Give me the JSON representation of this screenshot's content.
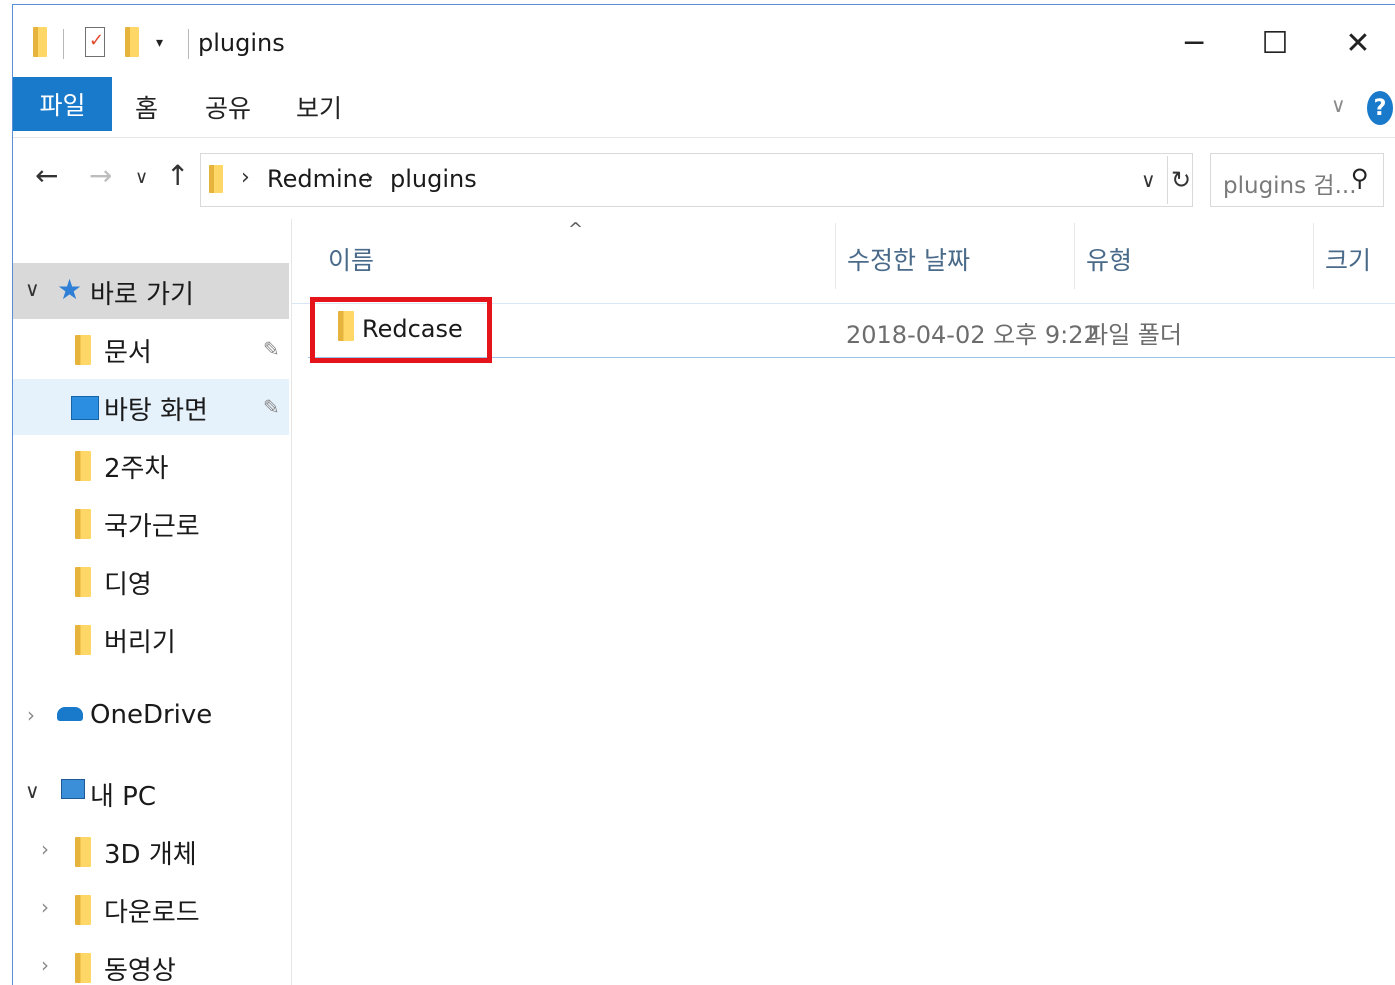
{
  "window": {
    "title": "plugins"
  },
  "quick_access_toolbar": {
    "dropdown_glyph": "▾"
  },
  "window_controls": {
    "minimize": "─",
    "maximize": "☐",
    "close": "✕"
  },
  "ribbon": {
    "tabs": [
      "파일",
      "홈",
      "공유",
      "보기"
    ],
    "expand_glyph": "∨",
    "help": "?"
  },
  "nav": {
    "back": "←",
    "forward": "→",
    "recent": "∨",
    "up": "↑"
  },
  "address": {
    "breadcrumbs": [
      "Redmine",
      "plugins"
    ],
    "separator": "›",
    "dropdown": "∨",
    "refresh": "↻"
  },
  "search": {
    "placeholder": "plugins 검...",
    "icon": "search-icon"
  },
  "sidebar": {
    "quick_access": {
      "label": "바로 가기",
      "expander": "∨"
    },
    "pinned": [
      {
        "label": "문서",
        "icon": "documents-icon"
      },
      {
        "label": "바탕 화면",
        "icon": "desktop-icon"
      }
    ],
    "folders": [
      "2주차",
      "국가근로",
      "디영",
      "버리기"
    ],
    "onedrive": {
      "label": "OneDrive",
      "expander": "›"
    },
    "this_pc": {
      "label": "내 PC",
      "expander": "∨",
      "children": [
        {
          "label": "3D 개체",
          "icon": "3d-objects-icon"
        },
        {
          "label": "다운로드",
          "icon": "downloads-icon"
        },
        {
          "label": "동영상",
          "icon": "videos-icon"
        }
      ]
    },
    "pin_glyph": "📌"
  },
  "file_list": {
    "sort_glyph": "^",
    "columns": [
      "이름",
      "수정한 날짜",
      "유형",
      "크기"
    ],
    "rows": [
      {
        "name": "Redcase",
        "modified": "2018-04-02 오후 9:22",
        "type": "파일 폴더",
        "size": ""
      }
    ]
  },
  "colors": {
    "accent": "#1979ca",
    "highlight_box": "#e5141b",
    "folder": "#ffd766"
  }
}
